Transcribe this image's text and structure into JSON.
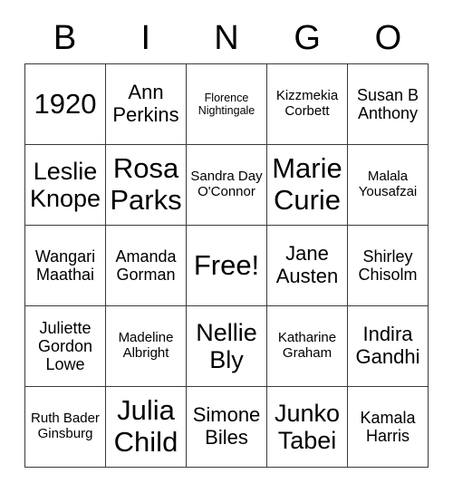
{
  "header": {
    "letters": [
      "B",
      "I",
      "N",
      "G",
      "O"
    ]
  },
  "grid": {
    "rows": [
      [
        {
          "text": "1920",
          "size": "fs-xxl"
        },
        {
          "text": "Ann Perkins",
          "size": "fs-lg"
        },
        {
          "text": "Florence Nightingale",
          "size": "fs-xs"
        },
        {
          "text": "Kizzmekia Corbett",
          "size": "fs-sm"
        },
        {
          "text": "Susan B Anthony",
          "size": "fs-md"
        }
      ],
      [
        {
          "text": "Leslie Knope",
          "size": "fs-xl"
        },
        {
          "text": "Rosa Parks",
          "size": "fs-xxl"
        },
        {
          "text": "Sandra Day O'Connor",
          "size": "fs-sm"
        },
        {
          "text": "Marie Curie",
          "size": "fs-xxl"
        },
        {
          "text": "Malala Yousafzai",
          "size": "fs-sm"
        }
      ],
      [
        {
          "text": "Wangari Maathai",
          "size": "fs-md"
        },
        {
          "text": "Amanda Gorman",
          "size": "fs-md"
        },
        {
          "text": "Free!",
          "size": "fs-xxl"
        },
        {
          "text": "Jane Austen",
          "size": "fs-lg"
        },
        {
          "text": "Shirley Chisolm",
          "size": "fs-md"
        }
      ],
      [
        {
          "text": "Juliette Gordon Lowe",
          "size": "fs-md"
        },
        {
          "text": "Madeline Albright",
          "size": "fs-sm"
        },
        {
          "text": "Nellie Bly",
          "size": "fs-xl"
        },
        {
          "text": "Katharine Graham",
          "size": "fs-sm"
        },
        {
          "text": "Indira Gandhi",
          "size": "fs-lg"
        }
      ],
      [
        {
          "text": "Ruth Bader Ginsburg",
          "size": "fs-sm"
        },
        {
          "text": "Julia Child",
          "size": "fs-xxl"
        },
        {
          "text": "Simone Biles",
          "size": "fs-lg"
        },
        {
          "text": "Junko Tabei",
          "size": "fs-xl"
        },
        {
          "text": "Kamala Harris",
          "size": "fs-md"
        }
      ]
    ]
  },
  "colors": {
    "border": "#3a3a3a",
    "background": "#ffffff",
    "text": "#000000"
  }
}
